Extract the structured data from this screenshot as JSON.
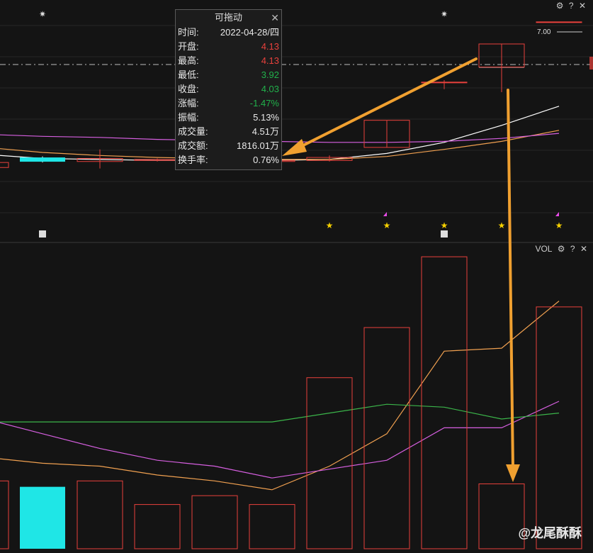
{
  "tooltip": {
    "title": "可拖动",
    "rows": [
      {
        "k": "时间:",
        "v": "2022-04-28/四",
        "cls": ""
      },
      {
        "k": "开盘:",
        "v": "4.13",
        "cls": "up"
      },
      {
        "k": "最高:",
        "v": "4.13",
        "cls": "up"
      },
      {
        "k": "最低:",
        "v": "3.92",
        "cls": "dn"
      },
      {
        "k": "收盘:",
        "v": "4.03",
        "cls": "dn"
      },
      {
        "k": "涨幅:",
        "v": "-1.47%",
        "cls": "dn"
      },
      {
        "k": "振幅:",
        "v": "5.13%",
        "cls": ""
      },
      {
        "k": "成交量:",
        "v": "4.51万",
        "cls": ""
      },
      {
        "k": "成交额:",
        "v": "1816.01万",
        "cls": ""
      },
      {
        "k": "换手率:",
        "v": "0.76%",
        "cls": ""
      }
    ]
  },
  "price_label": "7.00",
  "vol_panel": {
    "label": "VOL"
  },
  "watermark": "@龙尾酥酥",
  "colors": {
    "up": "#e8413c",
    "down": "#1fe6e6",
    "ma_white": "#ffffff",
    "ma_orange": "#f0a050",
    "ma_magenta": "#d65fe0",
    "ma_green": "#3bb54a",
    "arrow": "#f0a030"
  },
  "chart_data": {
    "type": "candlestick",
    "price_ylim": [
      3.6,
      6.0
    ],
    "vol_ylim": [
      0,
      10
    ],
    "candles": [
      {
        "open": 4.05,
        "close": 4.1,
        "high": 4.12,
        "low": 4.02
      },
      {
        "open": 4.15,
        "close": 4.12,
        "high": 4.16,
        "low": 4.1
      },
      {
        "open": 4.11,
        "close": 4.14,
        "high": 4.23,
        "low": 4.04
      },
      {
        "open": 4.12,
        "close": 4.13,
        "high": 4.14,
        "low": 4.11
      },
      {
        "open": 4.11,
        "close": 4.12,
        "high": 4.13,
        "low": 4.1
      },
      {
        "open": 4.11,
        "close": 4.12,
        "high": 4.14,
        "low": 4.1
      },
      {
        "open": 4.12,
        "close": 4.15,
        "high": 4.17,
        "low": 4.11
      },
      {
        "open": 4.25,
        "close": 4.52,
        "high": 4.52,
        "low": 4.25
      },
      {
        "open": 4.9,
        "close": 4.9,
        "high": 4.92,
        "low": 4.83
      },
      {
        "open": 5.05,
        "close": 5.28,
        "high": 5.28,
        "low": 4.8
      },
      {
        "open": 5.5,
        "close": 5.5,
        "high": 5.5,
        "low": 5.5
      },
      {
        "open": 5.55,
        "close": 5.55,
        "high": 5.55,
        "low": 5.55
      }
    ],
    "volumes": [
      2.3,
      2.1,
      2.3,
      1.5,
      1.8,
      1.5,
      5.8,
      7.5,
      9.9,
      2.2,
      8.2
    ],
    "vol_direction": [
      "up",
      "down",
      "up",
      "up",
      "up",
      "up",
      "up",
      "up",
      "up",
      "up",
      "up"
    ],
    "ma_price": [
      {
        "name": "MA5",
        "color": "white",
        "values": [
          4.18,
          4.14,
          4.13,
          4.12,
          4.12,
          4.12,
          4.13,
          4.19,
          4.3,
          4.47,
          4.66,
          4.9
        ]
      },
      {
        "name": "MA10",
        "color": "orange",
        "values": [
          4.25,
          4.2,
          4.17,
          4.15,
          4.14,
          4.13,
          4.13,
          4.16,
          4.23,
          4.31,
          4.42,
          4.55
        ]
      },
      {
        "name": "MA20",
        "color": "magenta",
        "values": [
          4.38,
          4.36,
          4.35,
          4.33,
          4.32,
          4.31,
          4.3,
          4.3,
          4.31,
          4.34,
          4.39,
          4.44
        ]
      }
    ],
    "ma_vol": [
      {
        "name": "MAV5",
        "color": "orange",
        "values": [
          3.1,
          2.9,
          2.8,
          2.5,
          2.3,
          2.0,
          2.8,
          3.9,
          6.7,
          6.8,
          8.4
        ]
      },
      {
        "name": "MAV10",
        "color": "magenta",
        "values": [
          4.4,
          3.9,
          3.4,
          3.0,
          2.8,
          2.4,
          2.7,
          3.0,
          4.1,
          4.1,
          5.0
        ]
      },
      {
        "name": "MAV20",
        "color": "green",
        "values": [
          4.3,
          4.3,
          4.3,
          4.3,
          4.3,
          4.3,
          4.6,
          4.9,
          4.8,
          4.4,
          4.6
        ]
      }
    ]
  }
}
